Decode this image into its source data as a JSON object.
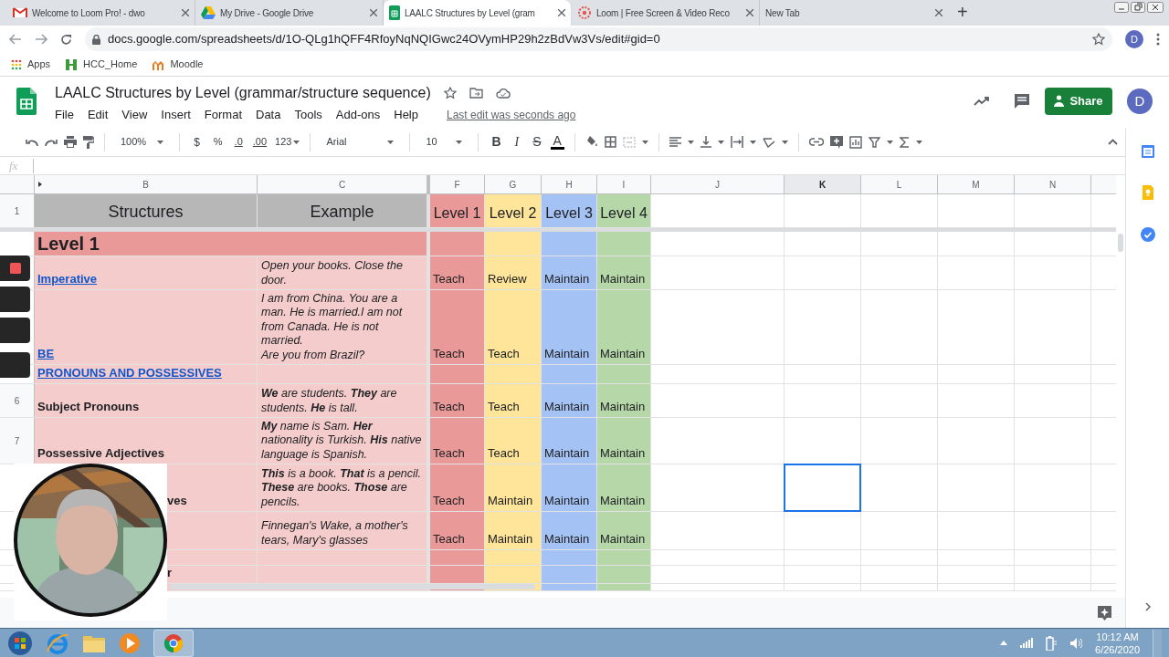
{
  "browser": {
    "tabs": [
      {
        "title": "Welcome to Loom Pro! - dwo",
        "selected": false
      },
      {
        "title": "My Drive - Google Drive",
        "selected": false
      },
      {
        "title": "LAALC Structures by Level (gram",
        "selected": true
      },
      {
        "title": "Loom | Free Screen & Video Reco",
        "selected": false
      },
      {
        "title": "New Tab",
        "selected": false
      }
    ],
    "new_tab": "+",
    "address": "docs.google.com/spreadsheets/d/1O-QLg1hQFF4RfoyNqNQIGwc24OVymHP29h2zBdVw3Vs/edit#gid=0",
    "profile": "D",
    "bookmarks": [
      "Apps",
      "HCC_Home",
      "Moodle"
    ]
  },
  "sheet": {
    "title": "LAALC Structures by Level (grammar/structure sequence)",
    "menus": [
      "File",
      "Edit",
      "View",
      "Insert",
      "Format",
      "Data",
      "Tools",
      "Add-ons",
      "Help"
    ],
    "last_edit": "Last edit was seconds ago",
    "share": "Share",
    "avatar": "D",
    "toolbar": {
      "zoom": "100%",
      "currency": "$",
      "percent": "%",
      "decrease_decimal": ".0",
      "increase_decimal": ".00",
      "number_format": "123",
      "font": "Arial",
      "font_size": "10",
      "bold": "B",
      "italic": "I",
      "strike": "S",
      "text_color": "A"
    },
    "formula_label": "fx"
  },
  "columns": [
    {
      "label": "B",
      "selected": false
    },
    {
      "label": "C",
      "selected": false
    },
    {
      "label": "F",
      "selected": false
    },
    {
      "label": "G",
      "selected": false
    },
    {
      "label": "H",
      "selected": false
    },
    {
      "label": "I",
      "selected": false
    },
    {
      "label": "J",
      "selected": false
    },
    {
      "label": "K",
      "selected": true
    },
    {
      "label": "L",
      "selected": false
    },
    {
      "label": "M",
      "selected": false
    },
    {
      "label": "N",
      "selected": false
    }
  ],
  "rows": [
    {
      "kind": "header",
      "number": "1",
      "selected": false,
      "b": "Structures",
      "c": "Example",
      "f": "Level 1",
      "g": "Level 2",
      "h": "Level 3",
      "i": "Level 4"
    },
    {
      "kind": "section",
      "selected": false,
      "b": "Level 1"
    },
    {
      "kind": "item",
      "selected": false,
      "b": "Imperative",
      "b_link": true,
      "c": "Open your books. Close the door.",
      "f": "Teach",
      "g": "Review",
      "h": "Maintain",
      "i": "Maintain"
    },
    {
      "kind": "item",
      "selected": false,
      "b": "BE",
      "b_link": true,
      "c": "I am from China. You are a man. He is married.I am not from Canada. He is not married.\nAre you from Brazil?",
      "f": "Teach",
      "g": "Teach",
      "h": "Maintain",
      "i": "Maintain"
    },
    {
      "kind": "item",
      "selected": false,
      "b": "PRONOUNS AND POSSESSIVES",
      "b_link": true
    },
    {
      "kind": "item",
      "number": "6",
      "selected": false,
      "b": "Subject Pronouns",
      "b_link": false,
      "c": "**We** are students. **They** are students. **He** is tall.",
      "f": "Teach",
      "g": "Teach",
      "h": "Maintain",
      "i": "Maintain"
    },
    {
      "kind": "item",
      "number": "7",
      "selected": false,
      "b": "Possessive Adjectives",
      "b_link": false,
      "c": "**My** name is Sam. **Her** nationality is Turkish. **His** native language is Spanish.",
      "f": "Teach",
      "g": "Teach",
      "h": "Maintain",
      "i": "Maintain"
    },
    {
      "kind": "item",
      "selected": true,
      "b": "ves",
      "b_link": false,
      "b_covered": true,
      "c": "**This** is a book. **That** is a pencil. **These** are books. **Those** are pencils.",
      "f": "Teach",
      "g": "Maintain",
      "h": "Maintain",
      "i": "Maintain"
    },
    {
      "kind": "item",
      "selected": false,
      "c": "Finnegan's Wake, a mother's tears, Mary's glasses",
      "f": "Teach",
      "g": "Maintain",
      "h": "Maintain",
      "i": "Maintain"
    },
    {
      "kind": "item",
      "selected": false
    },
    {
      "kind": "item",
      "selected": false,
      "b": "r",
      "b_link": false,
      "b_covered": true
    },
    {
      "kind": "item",
      "selected": false
    }
  ],
  "taskbar": {
    "time": "10:12 AM",
    "date": "6/26/2020"
  }
}
